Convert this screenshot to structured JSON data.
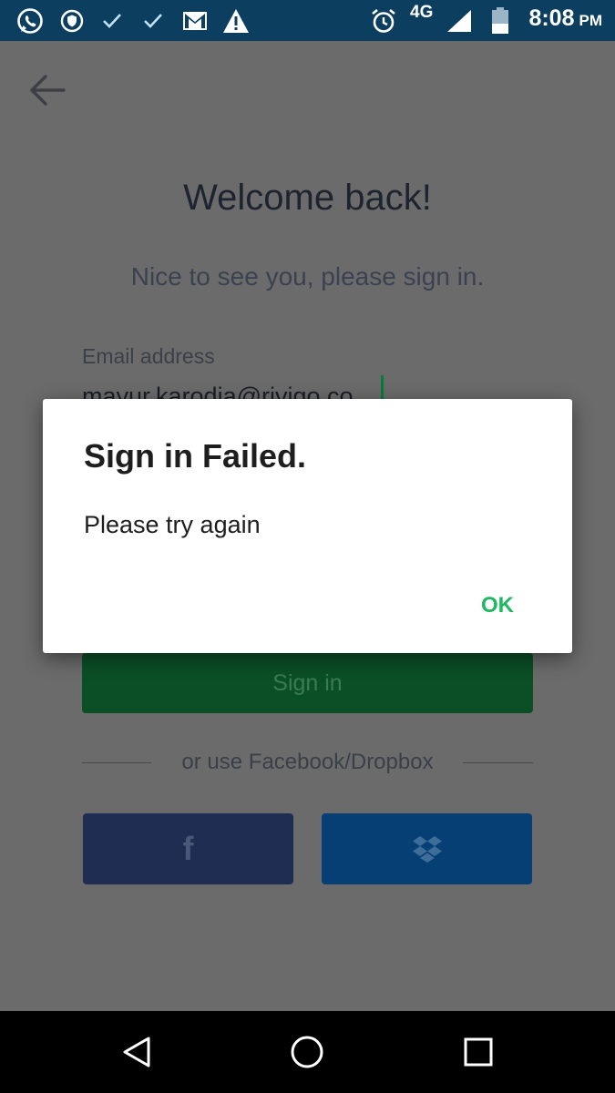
{
  "status_bar": {
    "network": "4G",
    "time": "8:08",
    "ampm": "PM",
    "icons": [
      "whatsapp-icon",
      "vpn-shield-icon",
      "check-icon",
      "check-icon",
      "gmail-icon",
      "warning-icon",
      "alarm-icon",
      "signal-icon",
      "battery-icon"
    ]
  },
  "screen": {
    "title": "Welcome back!",
    "subtitle": "Nice to see you, please sign in.",
    "email_label": "Email address",
    "email_value": "mayur.karodia@rivigo.co",
    "signin_label": "Sign in",
    "divider_text": "or use Facebook/Dropbox",
    "facebook_glyph": "f"
  },
  "dialog": {
    "title": "Sign in Failed.",
    "message": "Please try again",
    "ok_label": "OK"
  },
  "colors": {
    "status_bar_bg": "#0c3f5f",
    "overlay_bg": "#6b6b6b",
    "signin_bg": "#0b4f26",
    "facebook_bg": "#1f2d52",
    "dropbox_bg": "#053f74",
    "ok_color": "#1fb862"
  }
}
